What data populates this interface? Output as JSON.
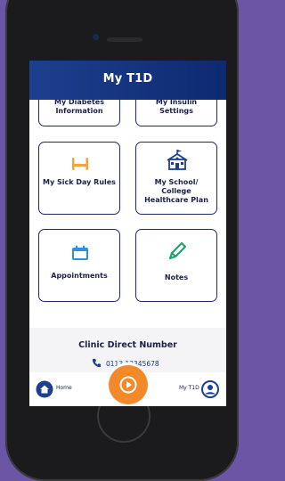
{
  "app": {
    "title": "My T1D"
  },
  "tiles": {
    "diabetes_info": "My Diabetes Information",
    "insulin_settings": "My Insulin Settings",
    "sick_day": "My Sick Day Rules",
    "school_plan": "My School/ College Healthcare Plan",
    "appointments": "Appointments",
    "notes": "Notes"
  },
  "clinic": {
    "title": "Clinic Direct Number",
    "number": "0113 12345678"
  },
  "tabbar": {
    "home": "Home",
    "me": "My T1D"
  },
  "colors": {
    "navy": "#1c3f8f",
    "ink": "#1a1f4a",
    "accent": "#f4892a",
    "background": "#6b56a6"
  }
}
